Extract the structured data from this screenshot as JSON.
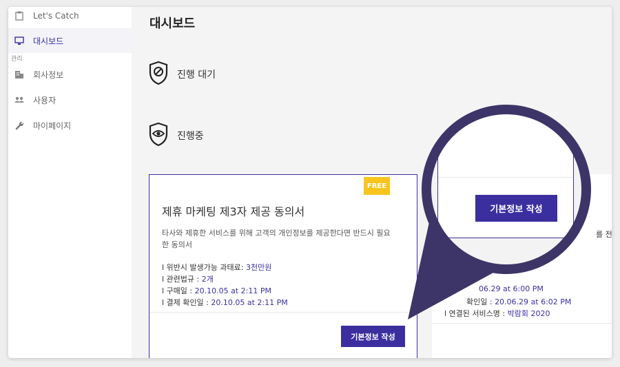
{
  "sidebar": {
    "items": [
      {
        "label": "Let's Catch",
        "icon": "clipboard-icon"
      },
      {
        "label": "대시보드",
        "icon": "monitor-icon"
      },
      {
        "label": "회사정보",
        "icon": "building-icon"
      },
      {
        "label": "사용자",
        "icon": "people-icon"
      },
      {
        "label": "마이페이지",
        "icon": "wrench-icon"
      }
    ],
    "section_label": "관리"
  },
  "main": {
    "title": "대시보드",
    "status_waiting": "진행 대기",
    "status_progress": "진행중"
  },
  "card": {
    "badge": "FREE",
    "title": "제휴 마케팅 제3자 제공 동의서",
    "description": "타사와 제휴한 서비스를 위해 고객의 개인정보를 제공한다면 반드시 필요한 동의서",
    "penalty_label": "l 위반시 발생가능 과태료: ",
    "penalty_value": "3천만원",
    "law_label": "l 관련법규 : ",
    "law_value": "2개",
    "purchase_label": "l 구매일 : ",
    "purchase_value": "20.10.05 at 2:11 PM",
    "confirm_label": "l 결제 확인일 : ",
    "confirm_value": "20.10.05 at 2:11 PM",
    "button": "기본정보 작성"
  },
  "card2": {
    "desc_fragment": "를 전",
    "purchase_value": "06.29 at 6:00 PM",
    "confirm_label": "확인일 : ",
    "confirm_value": "20.06.29 at 6:02 PM",
    "service_label": "l 연결된 서비스명 : ",
    "service_value": "박람회 2020"
  },
  "zoom": {
    "button": "기본정보 작성"
  },
  "colors": {
    "accent": "#3b2fa0",
    "callout": "#3d3567",
    "badge": "#f7c51d"
  }
}
